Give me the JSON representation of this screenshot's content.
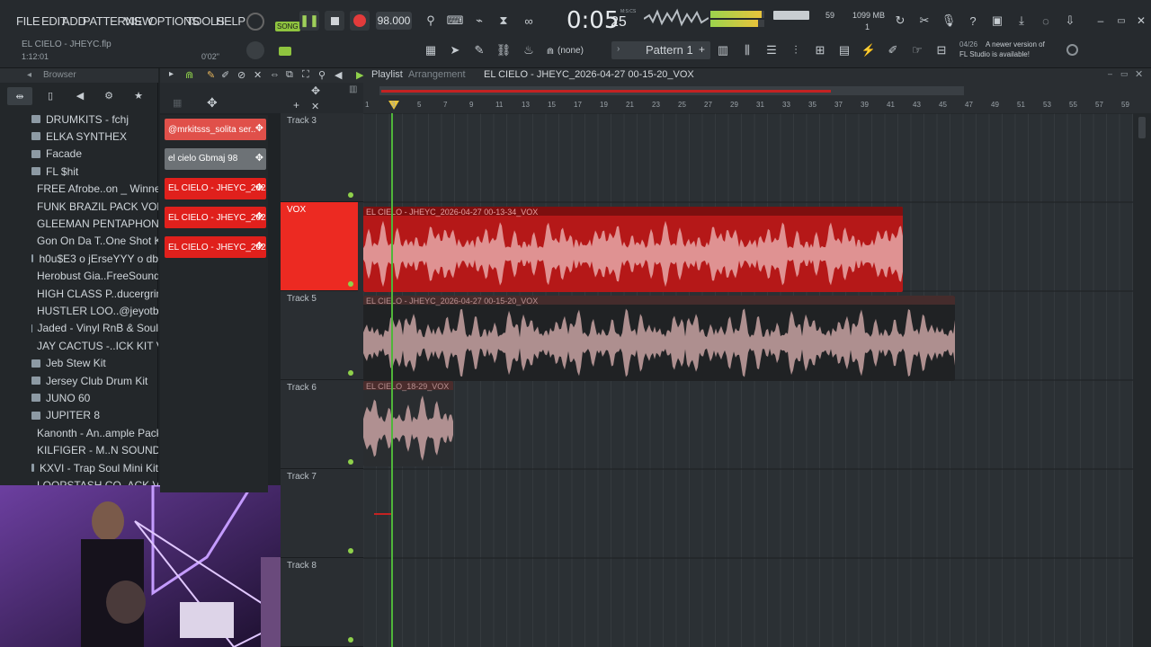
{
  "menu": [
    "FILE",
    "EDIT",
    "ADD",
    "PATTERNS",
    "VIEW",
    "OPTIONS",
    "TOOLS",
    "HELP"
  ],
  "project": {
    "file": "EL CIELO - JHEYC.flp",
    "time_small": "1:12:01",
    "knob": "0'02\""
  },
  "transport": {
    "song_label": "SONG",
    "tempo": "98.000",
    "time": "0:05",
    "time_sub": "25",
    "time_unit": "M:S:CS",
    "cpu": "59",
    "mem": "1099 MB",
    "voices": "1"
  },
  "pattern": {
    "name": "Pattern 1",
    "snap": "(none)"
  },
  "notice": {
    "date": "04/26",
    "text1": "A newer version of",
    "text2": "FL Studio is available!"
  },
  "browser": {
    "title": "Browser",
    "items": [
      "DRUMKITS - fchj",
      "ELKA SYNTHEX",
      "Facade",
      "FL $hit",
      "FREE Afrobe..on _ Winner)",
      "FUNK BRAZIL PACK VOL II",
      "GLEEMAN PENTAPHONIC",
      "Gon On Da T..One Shot Kit",
      "h0u$E3 o jErseYYY o db",
      "Herobust Gia..FreeSounds1",
      "HIGH CLASS P..ducergrind)",
      "HUSTLER LOO..@jeyotb808",
      "Jaded - Vinyl RnB & Soul",
      "JAY CACTUS -..ICK KIT VOL. 4",
      "Jeb Stew Kit",
      "Jersey Club Drum Kit",
      "JUNO 60",
      "JUPITER 8",
      "Kanonth - An..ample Pack!!",
      "KILFIGER - M..N SOUND KIT",
      "KXVI - Trap Soul Mini Kit",
      "LOOPSTASH CO..ACK VOL 1"
    ]
  },
  "playlist": {
    "title": "Playlist",
    "sub": "Arrangement",
    "current": "EL CIELO - JHEYC_2026-04-27 00-15-20_VOX"
  },
  "ruler": [
    "1",
    "3",
    "5",
    "7",
    "9",
    "11",
    "13",
    "15",
    "17",
    "19",
    "21",
    "23",
    "25",
    "27",
    "29",
    "31",
    "33",
    "35",
    "37",
    "39",
    "41",
    "43",
    "45",
    "47",
    "49",
    "51",
    "53",
    "55",
    "57",
    "59"
  ],
  "channels": [
    {
      "label": "@mrkitsss_solita ser..",
      "color": "#e0504a"
    },
    {
      "label": "el cielo Gbmaj 98",
      "color": "#6d7276"
    },
    {
      "label": "EL CIELO - JHEYC_2026-0..",
      "color": "#e0201c"
    },
    {
      "label": "EL CIELO - JHEYC_2026-0..",
      "color": "#e0201c"
    },
    {
      "label": "EL CIELO - JHEYC_2026-0..",
      "color": "#e0201c"
    }
  ],
  "tracks": [
    "Track 3",
    "VOX",
    "Track 5",
    "Track 6",
    "Track 7",
    "Track 8"
  ],
  "clips": [
    {
      "label": "EL CIELO - JHEYC_2026-04-27 00-13-34_VOX",
      "color": "#b51818"
    },
    {
      "label": "EL CIELO - JHEYC_2026-04-27 00-15-20_VOX",
      "color": "#202224"
    },
    {
      "label": "EL CIELO_18-29_VOX",
      "color": "#2a2d30"
    }
  ]
}
